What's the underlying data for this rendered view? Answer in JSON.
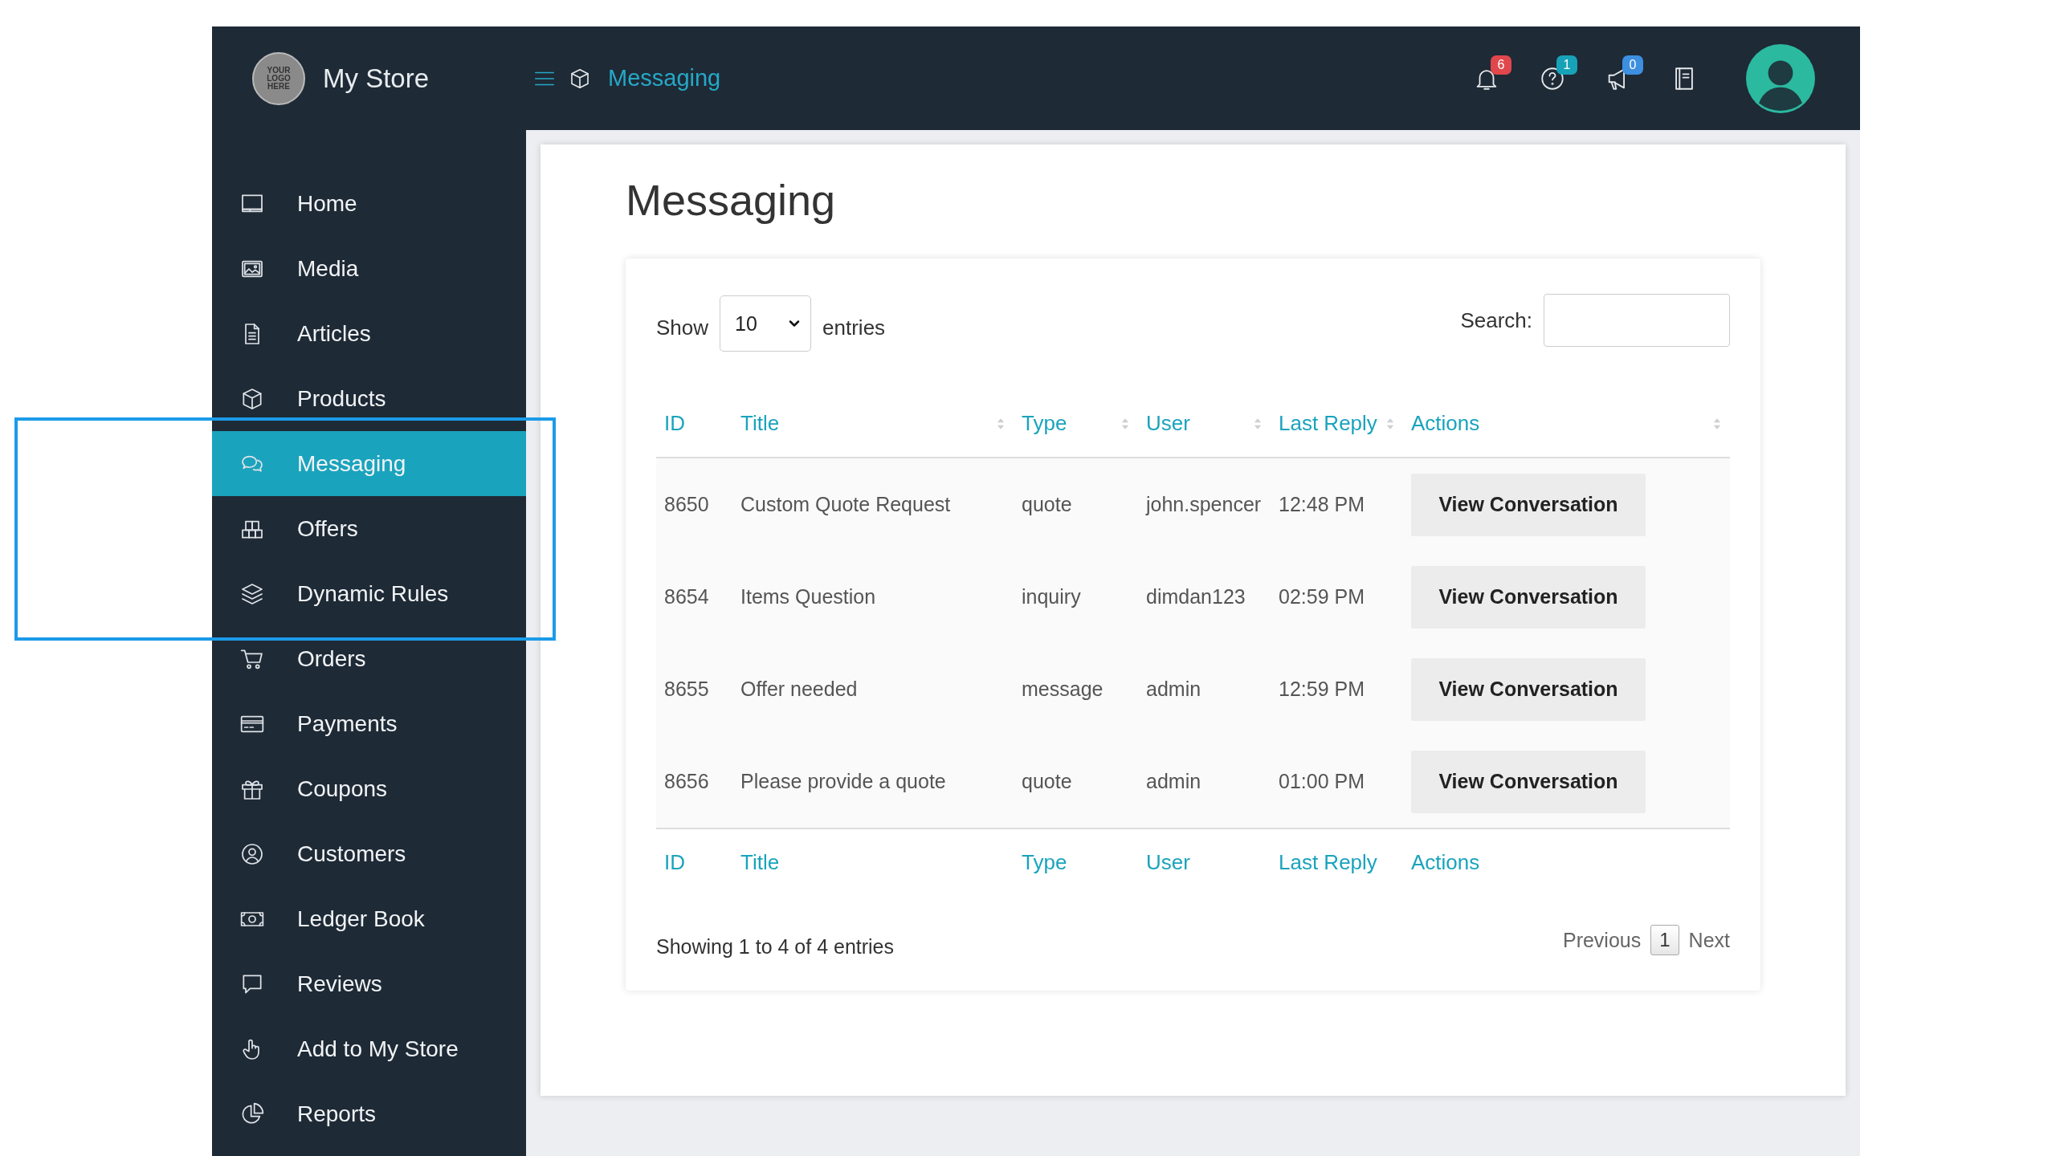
{
  "header": {
    "logo_text": "YOUR LOGO HERE",
    "store_name": "My Store",
    "breadcrumb": "Messaging",
    "notifications": [
      {
        "badge": "6",
        "color": "#e0474c"
      },
      {
        "badge": "1",
        "color": "#17a2b8"
      },
      {
        "badge": "0",
        "color": "#3d8fe0"
      }
    ]
  },
  "sidebar": {
    "items": [
      {
        "label": "Home",
        "selected": false
      },
      {
        "label": "Media",
        "selected": false
      },
      {
        "label": "Articles",
        "selected": false
      },
      {
        "label": "Products",
        "selected": false
      },
      {
        "label": "Messaging",
        "selected": true
      },
      {
        "label": "Offers",
        "selected": false
      },
      {
        "label": "Dynamic Rules",
        "selected": false
      },
      {
        "label": "Orders",
        "selected": false
      },
      {
        "label": "Payments",
        "selected": false
      },
      {
        "label": "Coupons",
        "selected": false
      },
      {
        "label": "Customers",
        "selected": false
      },
      {
        "label": "Ledger Book",
        "selected": false
      },
      {
        "label": "Reviews",
        "selected": false
      },
      {
        "label": "Add to My Store",
        "selected": false
      },
      {
        "label": "Reports",
        "selected": false
      }
    ]
  },
  "page_title": "Messaging",
  "table_controls": {
    "show_label": "Show",
    "page_size": "10",
    "entries_label": "entries",
    "search_label": "Search:"
  },
  "table": {
    "columns": [
      {
        "label": "ID",
        "sortable": false
      },
      {
        "label": "Title",
        "sortable": true
      },
      {
        "label": "Type",
        "sortable": true
      },
      {
        "label": "User",
        "sortable": true
      },
      {
        "label": "Last Reply",
        "sortable": true
      },
      {
        "label": "Actions",
        "sortable": true
      }
    ],
    "rows": [
      {
        "id": "8650",
        "title": "Custom Quote Request",
        "type": "quote",
        "user": "john.spencer",
        "last_reply": "12:48 PM",
        "action": "View Conversation"
      },
      {
        "id": "8654",
        "title": "Items Question",
        "type": "inquiry",
        "user": "dimdan123",
        "last_reply": "02:59 PM",
        "action": "View Conversation"
      },
      {
        "id": "8655",
        "title": "Offer needed",
        "type": "message",
        "user": "admin",
        "last_reply": "12:59 PM",
        "action": "View Conversation"
      },
      {
        "id": "8656",
        "title": "Please provide a quote",
        "type": "quote",
        "user": "admin",
        "last_reply": "01:00 PM",
        "action": "View Conversation"
      }
    ],
    "footer_columns": [
      "ID",
      "Title",
      "Type",
      "User",
      "Last Reply",
      "Actions"
    ]
  },
  "table_info": "Showing 1 to 4 of 4 entries",
  "pagination": {
    "previous": "Previous",
    "pages": [
      {
        "label": "1",
        "selected": true
      }
    ],
    "next": "Next"
  }
}
